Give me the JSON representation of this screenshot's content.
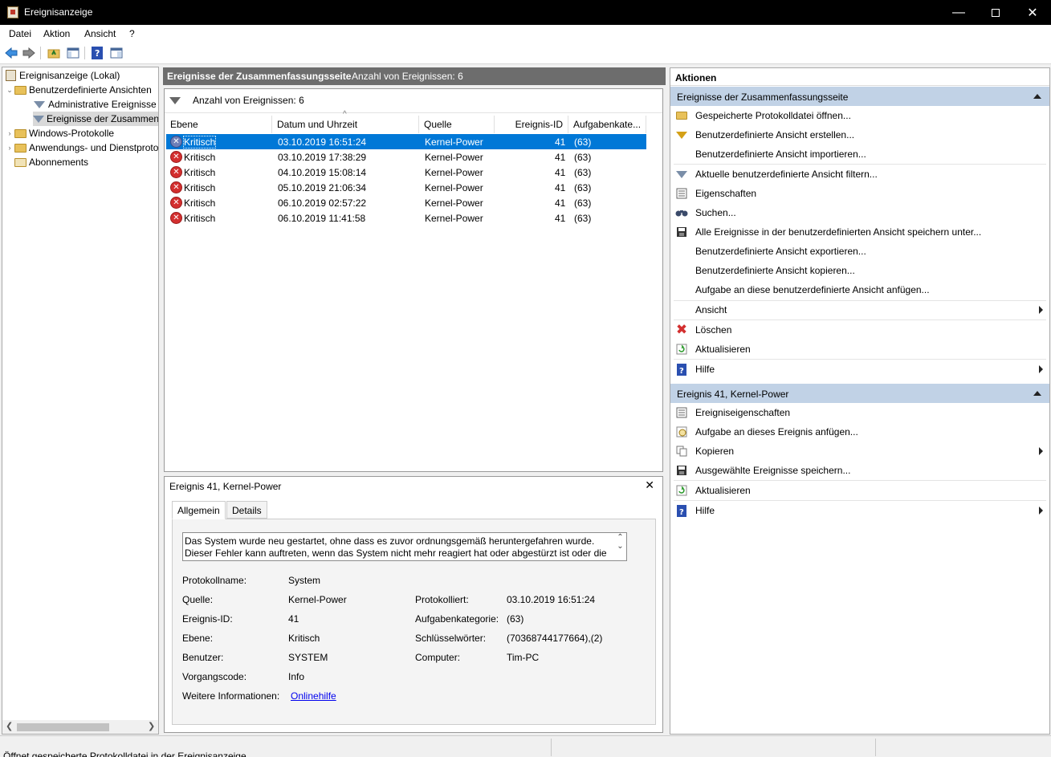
{
  "window": {
    "title": "Ereignisanzeige"
  },
  "menu": [
    "Datei",
    "Aktion",
    "Ansicht",
    "?"
  ],
  "tree": {
    "root": "Ereignisanzeige (Lokal)",
    "custom_views": "Benutzerdefinierte Ansichten",
    "admin_events": "Administrative Ereignisse",
    "summary_events": "Ereignisse der Zusammenfassungsseite",
    "windows_logs": "Windows-Protokolle",
    "app_logs": "Anwendungs- und Dienstprotokolle",
    "subscriptions": "Abonnements"
  },
  "middle": {
    "header_title": "Ereignisse der Zusammenfassungsseite",
    "header_count": "Anzahl von Ereignissen: 6",
    "filter_count": "Anzahl von Ereignissen: 6",
    "columns": [
      "Ebene",
      "Datum und Uhrzeit",
      "Quelle",
      "Ereignis-ID",
      "Aufgabenkate..."
    ],
    "rows": [
      {
        "level": "Kritisch",
        "date": "03.10.2019 16:51:24",
        "source": "Kernel-Power",
        "id": "41",
        "task": "(63)"
      },
      {
        "level": "Kritisch",
        "date": "03.10.2019 17:38:29",
        "source": "Kernel-Power",
        "id": "41",
        "task": "(63)"
      },
      {
        "level": "Kritisch",
        "date": "04.10.2019 15:08:14",
        "source": "Kernel-Power",
        "id": "41",
        "task": "(63)"
      },
      {
        "level": "Kritisch",
        "date": "05.10.2019 21:06:34",
        "source": "Kernel-Power",
        "id": "41",
        "task": "(63)"
      },
      {
        "level": "Kritisch",
        "date": "06.10.2019 02:57:22",
        "source": "Kernel-Power",
        "id": "41",
        "task": "(63)"
      },
      {
        "level": "Kritisch",
        "date": "06.10.2019 11:41:58",
        "source": "Kernel-Power",
        "id": "41",
        "task": "(63)"
      }
    ]
  },
  "detail": {
    "title": "Ereignis 41, Kernel-Power",
    "tabs": [
      "Allgemein",
      "Details"
    ],
    "description": "Das System wurde neu gestartet, ohne dass es zuvor ordnungsgemäß heruntergefahren wurde. Dieser Fehler kann auftreten, wenn das System nicht mehr reagiert hat oder abgestürzt ist oder die",
    "fields": {
      "log_name_label": "Protokollname:",
      "log_name": "System",
      "source_label": "Quelle:",
      "source": "Kernel-Power",
      "logged_label": "Protokolliert:",
      "logged": "03.10.2019 16:51:24",
      "event_id_label": "Ereignis-ID:",
      "event_id": "41",
      "task_cat_label": "Aufgabenkategorie:",
      "task_cat": "(63)",
      "level_label": "Ebene:",
      "level": "Kritisch",
      "keywords_label": "Schlüsselwörter:",
      "keywords": "(70368744177664),(2)",
      "user_label": "Benutzer:",
      "user": "SYSTEM",
      "computer_label": "Computer:",
      "computer": "Tim-PC",
      "opcode_label": "Vorgangscode:",
      "opcode": "Info",
      "more_info_label": "Weitere Informationen:",
      "more_info_link": "Onlinehilfe"
    }
  },
  "actions": {
    "header": "Aktionen",
    "section1": "Ereignisse der Zusammenfassungsseite",
    "section1_items": [
      "Gespeicherte Protokolldatei öffnen...",
      "Benutzerdefinierte Ansicht erstellen...",
      "Benutzerdefinierte Ansicht importieren...",
      "Aktuelle benutzerdefinierte Ansicht filtern...",
      "Eigenschaften",
      "Suchen...",
      "Alle Ereignisse in der benutzerdefinierten Ansicht speichern unter...",
      "Benutzerdefinierte Ansicht exportieren...",
      "Benutzerdefinierte Ansicht kopieren...",
      "Aufgabe an diese benutzerdefinierte Ansicht anfügen...",
      "Ansicht",
      "Löschen",
      "Aktualisieren",
      "Hilfe"
    ],
    "section2": "Ereignis 41, Kernel-Power",
    "section2_items": [
      "Ereigniseigenschaften",
      "Aufgabe an dieses Ereignis anfügen...",
      "Kopieren",
      "Ausgewählte Ereignisse speichern...",
      "Aktualisieren",
      "Hilfe"
    ]
  },
  "status": {
    "text": "Öffnet gespeicherte Protokolldatei in der Ereignisanzeige"
  }
}
